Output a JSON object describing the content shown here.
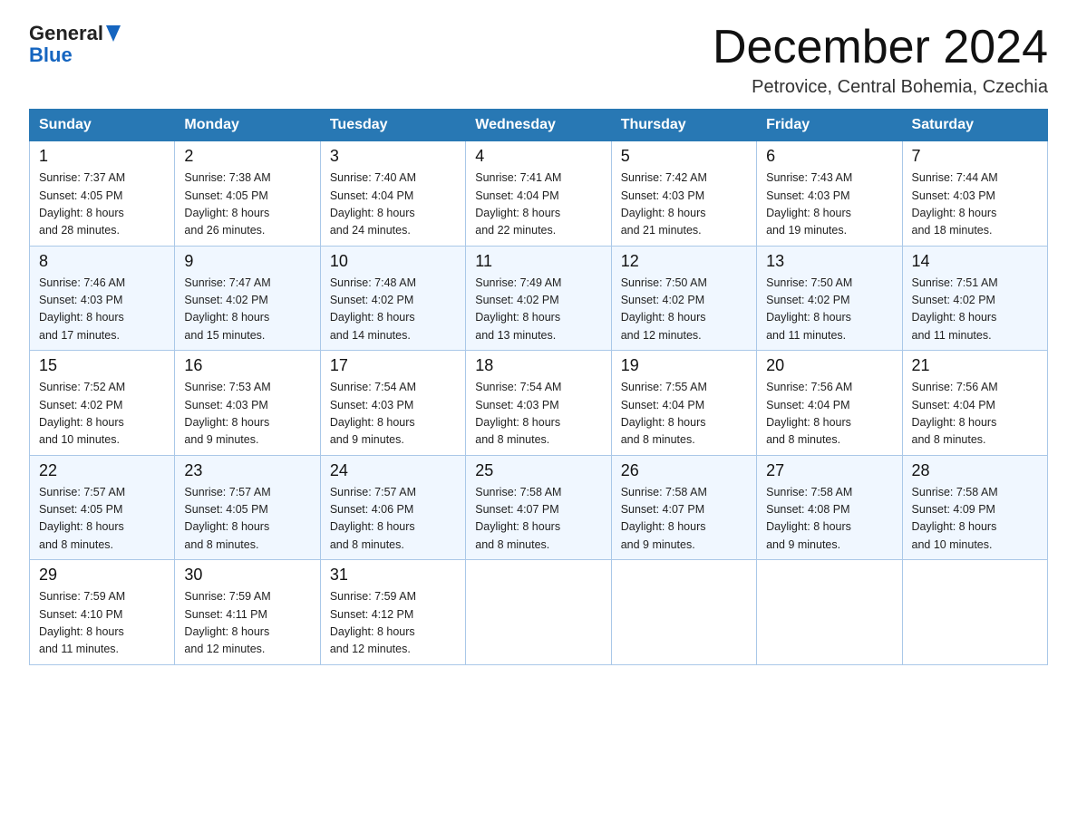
{
  "header": {
    "month_title": "December 2024",
    "location": "Petrovice, Central Bohemia, Czechia",
    "logo_general": "General",
    "logo_blue": "Blue"
  },
  "weekdays": [
    "Sunday",
    "Monday",
    "Tuesday",
    "Wednesday",
    "Thursday",
    "Friday",
    "Saturday"
  ],
  "weeks": [
    [
      {
        "day": "1",
        "sunrise": "7:37 AM",
        "sunset": "4:05 PM",
        "daylight": "8 hours and 28 minutes."
      },
      {
        "day": "2",
        "sunrise": "7:38 AM",
        "sunset": "4:05 PM",
        "daylight": "8 hours and 26 minutes."
      },
      {
        "day": "3",
        "sunrise": "7:40 AM",
        "sunset": "4:04 PM",
        "daylight": "8 hours and 24 minutes."
      },
      {
        "day": "4",
        "sunrise": "7:41 AM",
        "sunset": "4:04 PM",
        "daylight": "8 hours and 22 minutes."
      },
      {
        "day": "5",
        "sunrise": "7:42 AM",
        "sunset": "4:03 PM",
        "daylight": "8 hours and 21 minutes."
      },
      {
        "day": "6",
        "sunrise": "7:43 AM",
        "sunset": "4:03 PM",
        "daylight": "8 hours and 19 minutes."
      },
      {
        "day": "7",
        "sunrise": "7:44 AM",
        "sunset": "4:03 PM",
        "daylight": "8 hours and 18 minutes."
      }
    ],
    [
      {
        "day": "8",
        "sunrise": "7:46 AM",
        "sunset": "4:03 PM",
        "daylight": "8 hours and 17 minutes."
      },
      {
        "day": "9",
        "sunrise": "7:47 AM",
        "sunset": "4:02 PM",
        "daylight": "8 hours and 15 minutes."
      },
      {
        "day": "10",
        "sunrise": "7:48 AM",
        "sunset": "4:02 PM",
        "daylight": "8 hours and 14 minutes."
      },
      {
        "day": "11",
        "sunrise": "7:49 AM",
        "sunset": "4:02 PM",
        "daylight": "8 hours and 13 minutes."
      },
      {
        "day": "12",
        "sunrise": "7:50 AM",
        "sunset": "4:02 PM",
        "daylight": "8 hours and 12 minutes."
      },
      {
        "day": "13",
        "sunrise": "7:50 AM",
        "sunset": "4:02 PM",
        "daylight": "8 hours and 11 minutes."
      },
      {
        "day": "14",
        "sunrise": "7:51 AM",
        "sunset": "4:02 PM",
        "daylight": "8 hours and 11 minutes."
      }
    ],
    [
      {
        "day": "15",
        "sunrise": "7:52 AM",
        "sunset": "4:02 PM",
        "daylight": "8 hours and 10 minutes."
      },
      {
        "day": "16",
        "sunrise": "7:53 AM",
        "sunset": "4:03 PM",
        "daylight": "8 hours and 9 minutes."
      },
      {
        "day": "17",
        "sunrise": "7:54 AM",
        "sunset": "4:03 PM",
        "daylight": "8 hours and 9 minutes."
      },
      {
        "day": "18",
        "sunrise": "7:54 AM",
        "sunset": "4:03 PM",
        "daylight": "8 hours and 8 minutes."
      },
      {
        "day": "19",
        "sunrise": "7:55 AM",
        "sunset": "4:04 PM",
        "daylight": "8 hours and 8 minutes."
      },
      {
        "day": "20",
        "sunrise": "7:56 AM",
        "sunset": "4:04 PM",
        "daylight": "8 hours and 8 minutes."
      },
      {
        "day": "21",
        "sunrise": "7:56 AM",
        "sunset": "4:04 PM",
        "daylight": "8 hours and 8 minutes."
      }
    ],
    [
      {
        "day": "22",
        "sunrise": "7:57 AM",
        "sunset": "4:05 PM",
        "daylight": "8 hours and 8 minutes."
      },
      {
        "day": "23",
        "sunrise": "7:57 AM",
        "sunset": "4:05 PM",
        "daylight": "8 hours and 8 minutes."
      },
      {
        "day": "24",
        "sunrise": "7:57 AM",
        "sunset": "4:06 PM",
        "daylight": "8 hours and 8 minutes."
      },
      {
        "day": "25",
        "sunrise": "7:58 AM",
        "sunset": "4:07 PM",
        "daylight": "8 hours and 8 minutes."
      },
      {
        "day": "26",
        "sunrise": "7:58 AM",
        "sunset": "4:07 PM",
        "daylight": "8 hours and 9 minutes."
      },
      {
        "day": "27",
        "sunrise": "7:58 AM",
        "sunset": "4:08 PM",
        "daylight": "8 hours and 9 minutes."
      },
      {
        "day": "28",
        "sunrise": "7:58 AM",
        "sunset": "4:09 PM",
        "daylight": "8 hours and 10 minutes."
      }
    ],
    [
      {
        "day": "29",
        "sunrise": "7:59 AM",
        "sunset": "4:10 PM",
        "daylight": "8 hours and 11 minutes."
      },
      {
        "day": "30",
        "sunrise": "7:59 AM",
        "sunset": "4:11 PM",
        "daylight": "8 hours and 12 minutes."
      },
      {
        "day": "31",
        "sunrise": "7:59 AM",
        "sunset": "4:12 PM",
        "daylight": "8 hours and 12 minutes."
      },
      null,
      null,
      null,
      null
    ]
  ],
  "labels": {
    "sunrise": "Sunrise:",
    "sunset": "Sunset:",
    "daylight": "Daylight:"
  }
}
